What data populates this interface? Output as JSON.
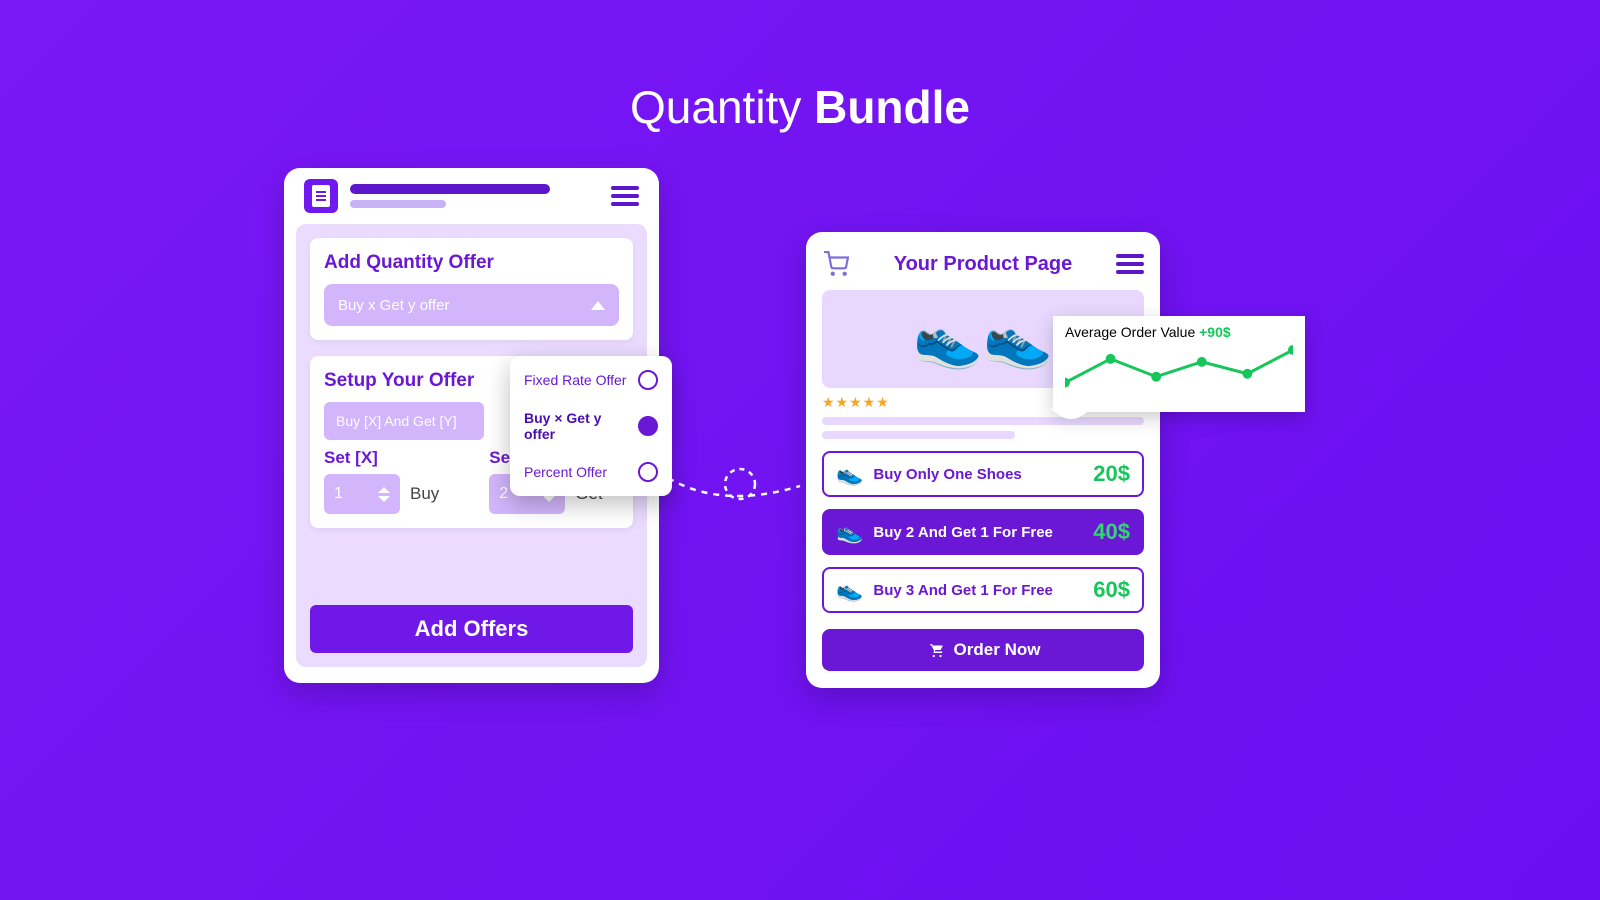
{
  "title": {
    "light": "Quantity ",
    "bold": "Bundle"
  },
  "left": {
    "block1": {
      "title": "Add Quantity Offer",
      "select_placeholder": "Buy x Get y offer"
    },
    "dropdown": {
      "options": [
        {
          "label": "Fixed Rate Offer",
          "selected": false
        },
        {
          "label": "Buy × Get y offer",
          "selected": true
        },
        {
          "label": "Percent Offer",
          "selected": false
        }
      ]
    },
    "block2": {
      "title": "Setup Your Offer",
      "template_placeholder": "Buy [X] And Get [Y]",
      "setx_label": "Set [X]",
      "sety_label": "Set [Y]",
      "x_value": "1",
      "y_value": "2",
      "buy_suffix": "Buy",
      "get_suffix": "Get"
    },
    "add_button": "Add Offers"
  },
  "right": {
    "title": "Your Product Page",
    "stars": "★★★★★",
    "offers": [
      {
        "text": "Buy Only One Shoes",
        "price": "20$",
        "active": false
      },
      {
        "text": "Buy 2 And Get 1 For Free",
        "price": "40$",
        "active": true
      },
      {
        "text": "Buy 3 And Get 1 For Free",
        "price": "60$",
        "active": false
      }
    ],
    "order_button": "Order Now"
  },
  "aov": {
    "label": "Average Order Value ",
    "delta": "+90$"
  },
  "chart_data": {
    "type": "line",
    "title": "Average Order Value +90$",
    "x": [
      0,
      1,
      2,
      3,
      4,
      5
    ],
    "values": [
      35,
      75,
      45,
      70,
      50,
      90
    ],
    "ylim": [
      0,
      100
    ],
    "xlabel": "",
    "ylabel": ""
  }
}
